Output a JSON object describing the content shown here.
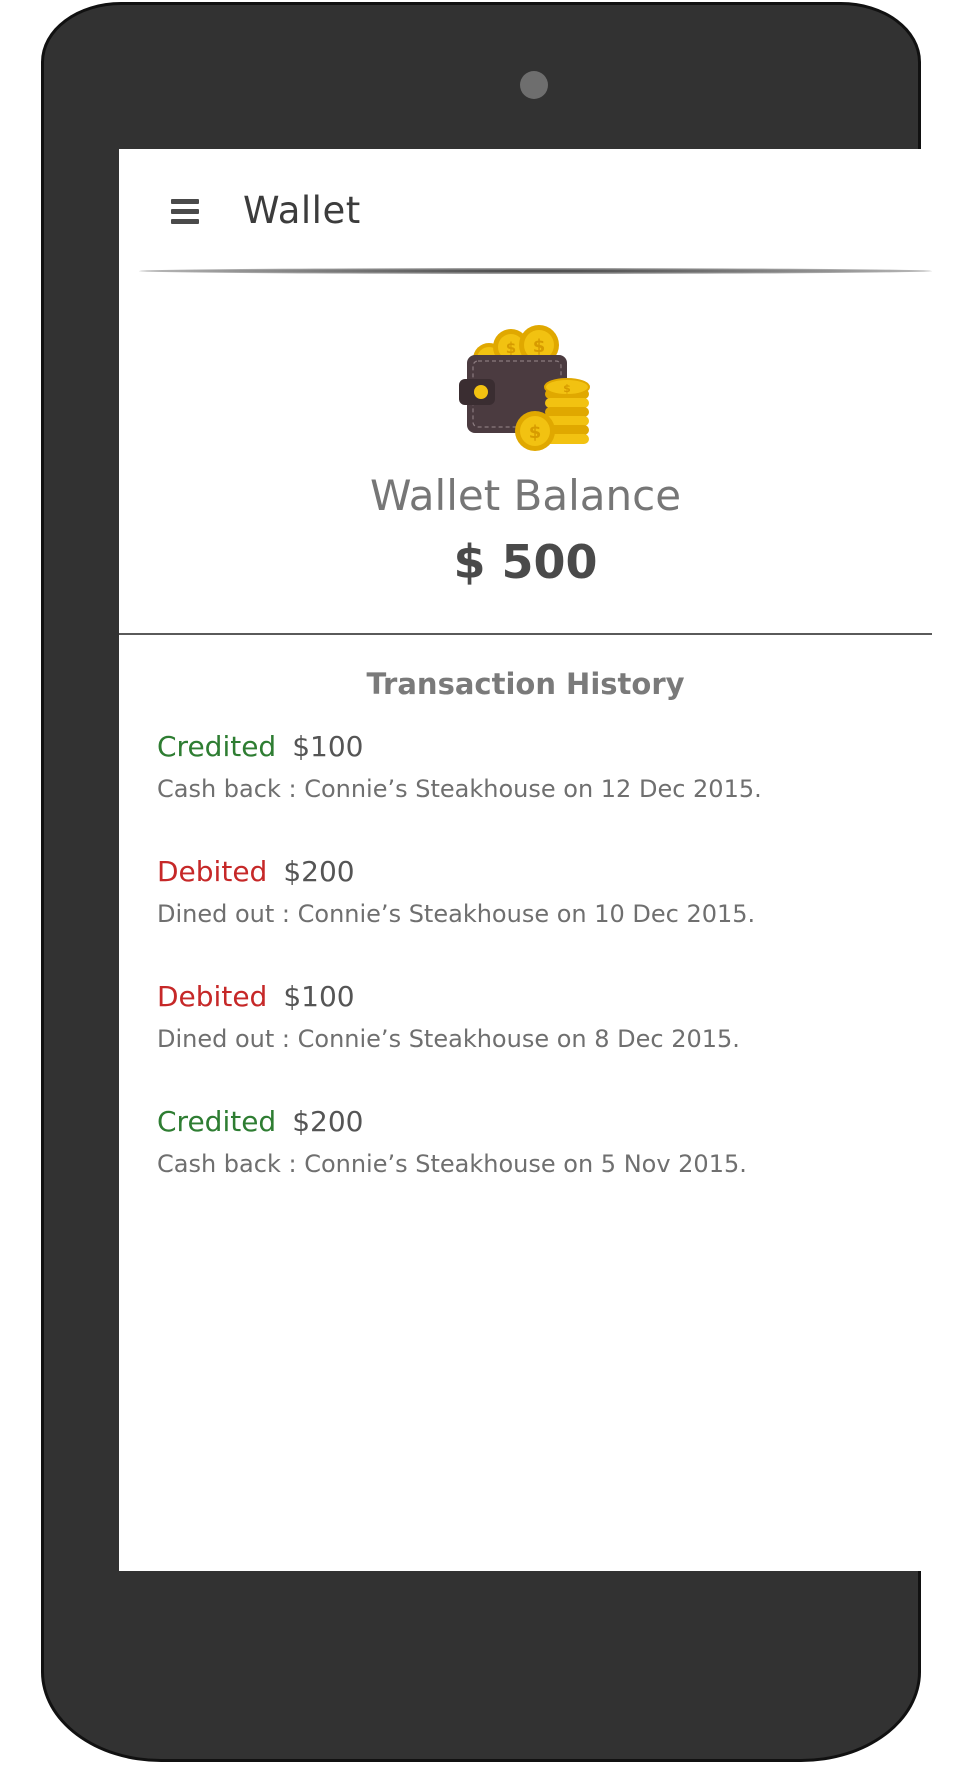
{
  "app_bar": {
    "title": "Wallet",
    "menu_icon": "hamburger-menu-icon"
  },
  "balance": {
    "label": "Wallet Balance",
    "amount": "$ 500",
    "illustration": "wallet-with-coins-icon"
  },
  "history": {
    "title": "Transaction History",
    "transactions": [
      {
        "type": "Credited",
        "amount": "$100",
        "description": "Cash back : Connie’s Steakhouse on 12 Dec 2015."
      },
      {
        "type": "Debited",
        "amount": "$200",
        "description": "Dined out : Connie’s Steakhouse on 10 Dec 2015."
      },
      {
        "type": "Debited",
        "amount": "$100",
        "description": "Dined out : Connie’s Steakhouse on 8 Dec 2015."
      },
      {
        "type": "Credited",
        "amount": "$200",
        "description": "Cash back : Connie’s Steakhouse on 5 Nov 2015."
      }
    ]
  },
  "colors": {
    "credited": "#2e7d32",
    "debited": "#c62828",
    "device_body": "#323232",
    "coin_gold": "#f2c211",
    "wallet_brown": "#4b3b40"
  }
}
